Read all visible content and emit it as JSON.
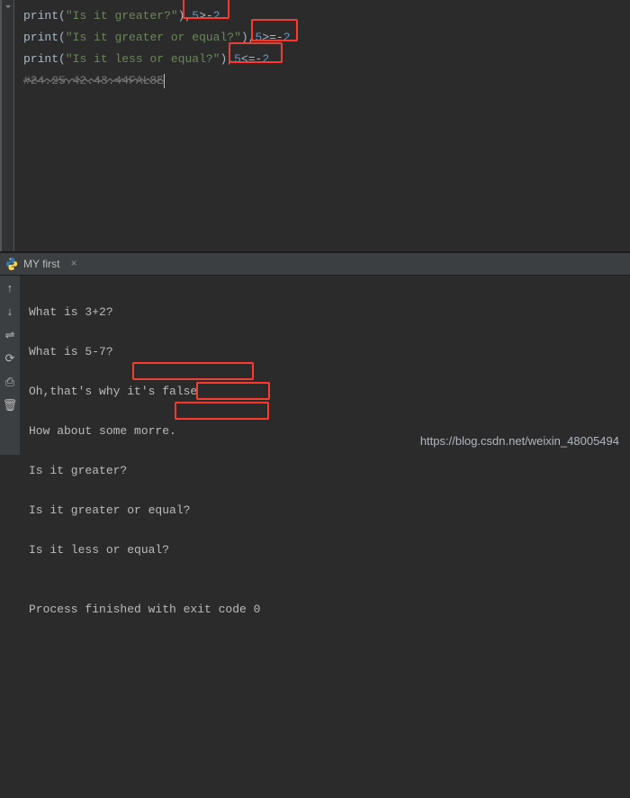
{
  "editor": {
    "lines": [
      {
        "fn": "print",
        "open": "(\"",
        "str": "Is it greater?",
        "close": "\")",
        "expr": ",5>-2",
        "expr_num1": "5",
        "expr_op": ">-",
        "expr_num2": "2"
      },
      {
        "fn": "print",
        "open": "(\"",
        "str": "Is it greater or equal?",
        "close": "\")",
        "expr": ",5>=-2",
        "expr_num1": "5",
        "expr_op": ">=-",
        "expr_num2": "2"
      },
      {
        "fn": "print",
        "open": "(\"",
        "str": "Is it less or equal?",
        "close": "\")",
        "expr": ",5<=-2",
        "expr_num1": "5",
        "expr_op": "<=-",
        "expr_num2": "2"
      }
    ],
    "comment": "#24.25.42.43.44FALSE"
  },
  "tab": {
    "title": "MY first",
    "close": "×"
  },
  "console": {
    "lines": [
      "What is 3+2?",
      "What is 5-7?",
      "Oh,that's why it's false.",
      "How about some morre.",
      "Is it greater?",
      "Is it greater or equal?",
      "Is it less or equal?",
      "",
      "Process finished with exit code 0"
    ]
  },
  "watermark": "https://blog.csdn.net/weixin_48005494",
  "icons": {
    "arrow_up": "↑",
    "arrow_down": "↓",
    "wrap": "⇌",
    "reload": "⟳",
    "print": "⎙",
    "trash": "🗑"
  }
}
